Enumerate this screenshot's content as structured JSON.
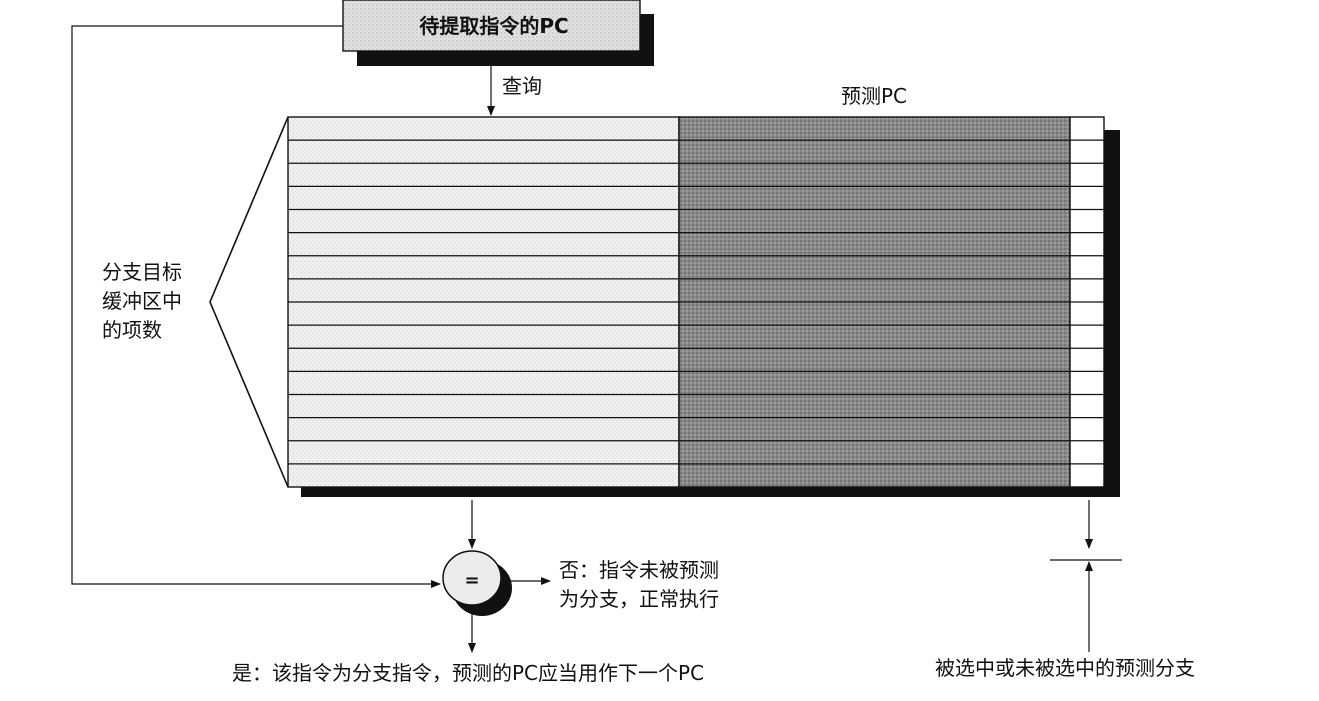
{
  "pc_box_label": "待提取指令的PC",
  "lookup_label": "查询",
  "predicted_pc_label": "预测PC",
  "entries_label_lines": [
    "分支目标",
    "缓冲区中",
    "的项数"
  ],
  "compare_symbol": "=",
  "no_label_lines": [
    "否：指令未被预测",
    "为分支，正常执行"
  ],
  "yes_label": "是：该指令为分支指令，预测的PC应当用作下一个PC",
  "taken_label": "被选中或未被选中的预测分支",
  "colors": {
    "box_fill": "#e2e2e2",
    "shadow": "#111111",
    "left_column_fill": "#f1f1f1",
    "right_column_fill": "#8a8a8a",
    "comparator_fill": "#ececec"
  },
  "table": {
    "row_count": 16
  }
}
